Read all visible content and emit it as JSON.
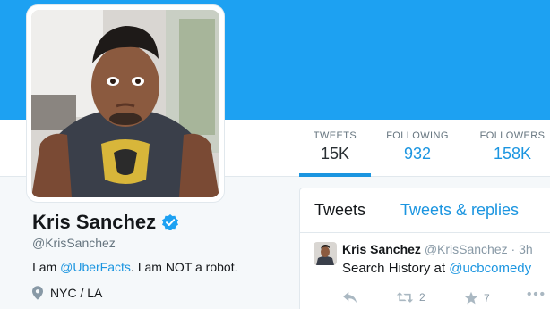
{
  "colors": {
    "header": "#1da1f2",
    "accent": "#1b95e0"
  },
  "stats": [
    {
      "label": "TWEETS",
      "value": "15K"
    },
    {
      "label": "FOLLOWING",
      "value": "932"
    },
    {
      "label": "FOLLOWERS",
      "value": "158K"
    }
  ],
  "profile": {
    "name": "Kris Sanchez",
    "handle": "@KrisSanchez",
    "bio_prefix": "I am ",
    "bio_link": "@UberFacts",
    "bio_suffix": ". I am NOT a robot.",
    "location": "NYC / LA"
  },
  "timeline": {
    "tabs": [
      "Tweets",
      "Tweets & replies"
    ],
    "tweet": {
      "name": "Kris Sanchez",
      "handle_time": "@KrisSanchez · 3h",
      "text_prefix": "Search History at ",
      "text_link": "@ucbcomedy",
      "retweets": "2",
      "likes": "7"
    }
  }
}
